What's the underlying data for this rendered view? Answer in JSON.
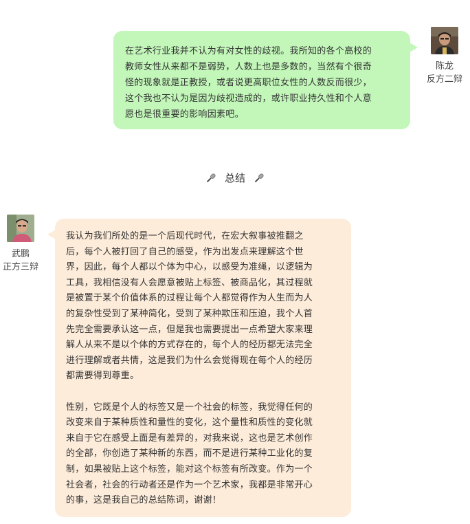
{
  "messages": [
    {
      "side": "right",
      "speaker_name": "陈龙",
      "speaker_role": "反方二辩",
      "bubble_color": "#c2f7b9",
      "lines": [
        "在艺术行业我并不认为有对女性的歧视。我所知的各个高校的",
        "教师女性从来都不是弱势，人数上也是多数的，当然有个很奇",
        "怪的现象就是正教授，或者说更高职位女性的人数反而很少，",
        "这个我也不认为是因为歧视造成的，或许职业持久性和个人意",
        "愿也是很重要的影响因素吧。"
      ]
    },
    {
      "side": "left",
      "speaker_name": "武鹏",
      "speaker_role": "正方三辩",
      "bubble_color": "#fdecda",
      "paragraphs": [
        [
          "我认为我们所处的是一个后现代时代，在宏大叙事被推翻之",
          "后，每个人被打回了自己的感受，作为出发点来理解这个世",
          "界，因此，每个人都以个体为中心，以感受为准绳，以逻辑为",
          "工具，我相信没有人会愿意被贴上标签、被商品化，其过程就",
          "是被置于某个价值体系的过程让每个人都觉得作为人生而为人",
          "的复杂性受到了某种简化，受到了某种欺压和压迫，我个人首",
          "先完全需要承认这一点，但是我也需要提出一点希望大家来理",
          "解人从来不是以个体的方式存在的，每个人的经历都无法完全",
          "进行理解或者共情，这是我们为什么会觉得现在每个人的经历",
          "都需要得到尊重。"
        ],
        [
          "性别，它既是个人的标签又是一个社会的标签，我觉得任何的",
          "改变来自于某种质性和量性的变化，这个量性和质性的变化就",
          "来自于它在感受上面是有差异的，对我来说，这也是艺术创作",
          "的全部，你创造了某种新的东西，而不是进行某种工业化的复",
          "制，如果被贴上这个标签，能对这个标签有所改变。作为一个",
          "社会者，社会的行动者还是作为一个艺术家，我都是非常开心",
          "的事，这是我自己的总结陈词，谢谢！"
        ]
      ]
    }
  ],
  "section_title": {
    "label": "总结",
    "icon": "microphone-icon"
  }
}
